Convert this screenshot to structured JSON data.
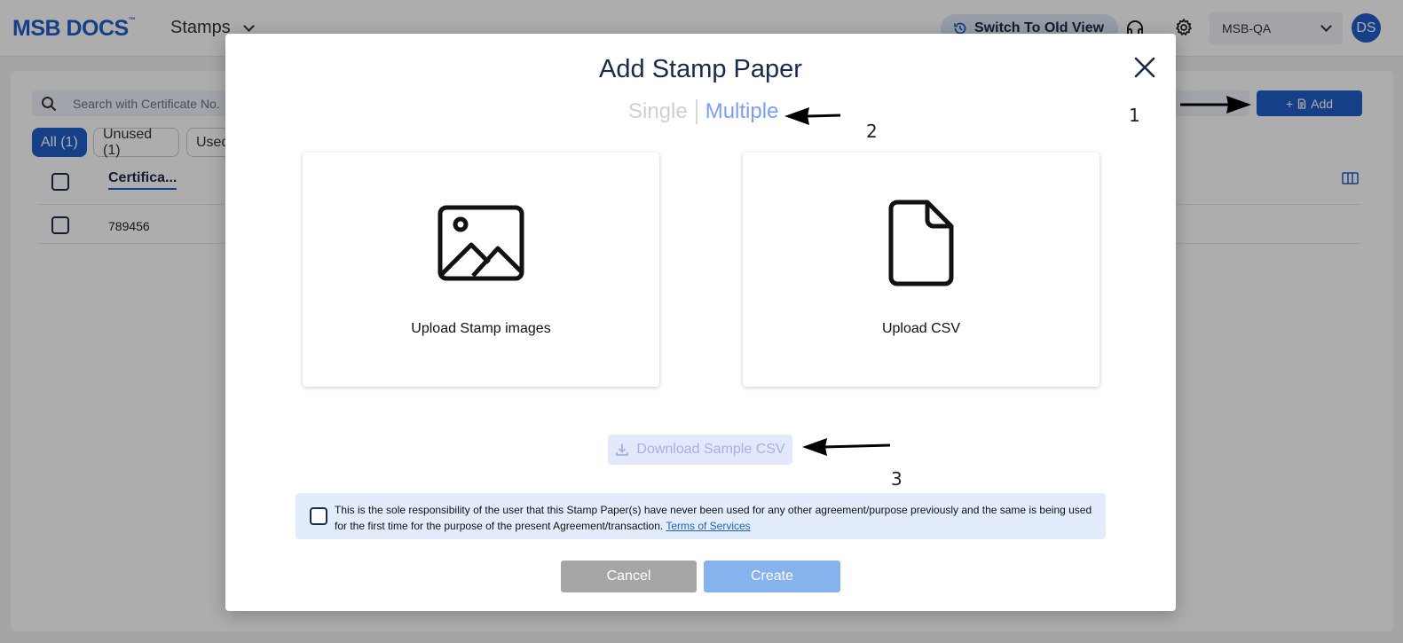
{
  "app": {
    "logo": "MSB DOCS",
    "logo_tm": "™",
    "module": "Stamps",
    "switch_view_label": "Switch To Old View",
    "org": "MSB-QA",
    "avatar_initials": "DS"
  },
  "toolbar": {
    "search_placeholder": "Search with Certificate No.",
    "add_label": "Add"
  },
  "filters": [
    {
      "label": "All (1)",
      "active": true
    },
    {
      "label": "Unused (1)",
      "active": false
    },
    {
      "label": "Used",
      "active": false
    }
  ],
  "table": {
    "columns": [
      "Certifica..."
    ],
    "rows": [
      {
        "certificate": "789456"
      }
    ]
  },
  "modal": {
    "title": "Add Stamp Paper",
    "tabs": {
      "single": "Single",
      "multiple": "Multiple",
      "active": "Multiple"
    },
    "cards": [
      {
        "label": "Upload Stamp images",
        "icon": "image-icon"
      },
      {
        "label": "Upload CSV",
        "icon": "file-icon"
      }
    ],
    "download_label": "Download Sample CSV",
    "disclaimer": "This is the sole responsibility of the user that this Stamp Paper(s) have never been used for any other agreement/purpose previously and the same is being used for the first time for the purpose of the present Agreement/transaction.",
    "terms_link": "Terms of Services",
    "cancel_label": "Cancel",
    "create_label": "Create"
  },
  "annotations": [
    "1",
    "2",
    "3"
  ],
  "colors": {
    "brand": "#1f5fc9",
    "title": "#1b2a4a",
    "multiple_active": "#7a9ff0",
    "create_disabled": "#86b2ee",
    "cancel": "#a6a6a6"
  }
}
